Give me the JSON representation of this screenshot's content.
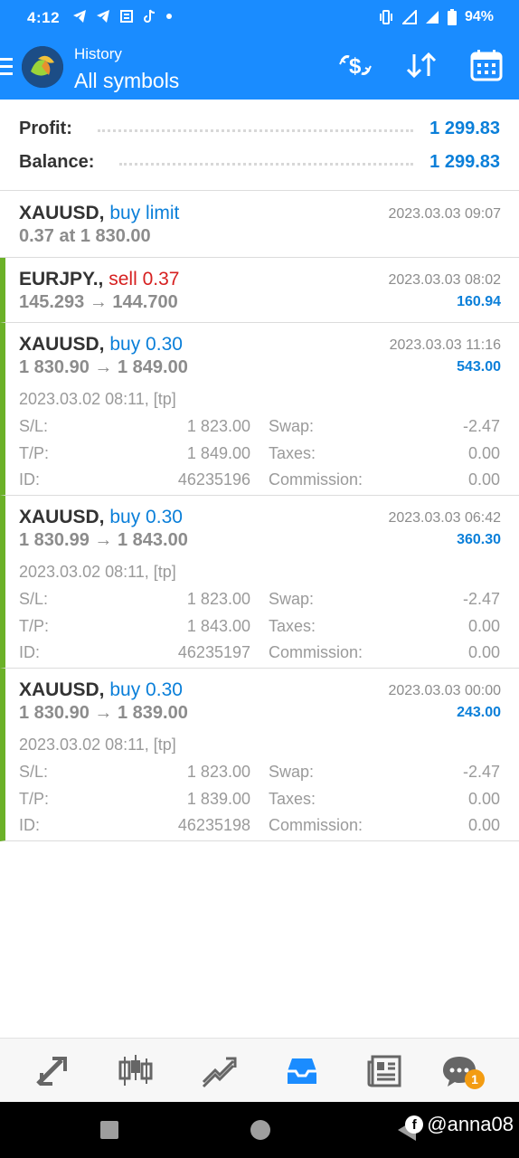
{
  "status_bar": {
    "time": "4:12",
    "battery": "94%"
  },
  "header": {
    "subtitle": "History",
    "title": "All symbols"
  },
  "summary": {
    "profit_label": "Profit:",
    "profit_value": "1 299.83",
    "balance_label": "Balance:",
    "balance_value": "1 299.83"
  },
  "trades": [
    {
      "symbol": "XAUUSD,",
      "action": "buy limit",
      "action_type": "buy",
      "line2": "0.37 at 1 830.00",
      "time": "2023.03.03 09:07",
      "profit": "",
      "closed": false
    },
    {
      "symbol": "EURJPY.,",
      "action": "sell 0.37",
      "action_type": "sell",
      "line2": "145.293 → 144.700",
      "time": "2023.03.03 08:02",
      "profit": "160.94",
      "closed": true
    },
    {
      "symbol": "XAUUSD,",
      "action": "buy 0.30",
      "action_type": "buy",
      "line2": "1 830.90 → 1 849.00",
      "time": "2023.03.03 11:16",
      "profit": "543.00",
      "closed": true,
      "open_info": "2023.03.02 08:11, [tp]",
      "sl": "1 823.00",
      "tp": "1 849.00",
      "id": "46235196",
      "swap": "-2.47",
      "taxes": "0.00",
      "commission": "0.00"
    },
    {
      "symbol": "XAUUSD,",
      "action": "buy 0.30",
      "action_type": "buy",
      "line2": "1 830.99 → 1 843.00",
      "time": "2023.03.03 06:42",
      "profit": "360.30",
      "closed": true,
      "open_info": "2023.03.02 08:11, [tp]",
      "sl": "1 823.00",
      "tp": "1 843.00",
      "id": "46235197",
      "swap": "-2.47",
      "taxes": "0.00",
      "commission": "0.00"
    },
    {
      "symbol": "XAUUSD,",
      "action": "buy 0.30",
      "action_type": "buy",
      "line2": "1 830.90 → 1 839.00",
      "time": "2023.03.03 00:00",
      "profit": "243.00",
      "closed": true,
      "open_info": "2023.03.02 08:11, [tp]",
      "sl": "1 823.00",
      "tp": "1 839.00",
      "id": "46235198",
      "swap": "-2.47",
      "taxes": "0.00",
      "commission": "0.00"
    }
  ],
  "labels": {
    "sl": "S/L:",
    "tp": "T/P:",
    "id": "ID:",
    "swap": "Swap:",
    "taxes": "Taxes:",
    "commission": "Commission:"
  },
  "bottom_nav": {
    "items": [
      "quotes-icon",
      "chart-icon",
      "trade-icon",
      "history-icon",
      "news-icon",
      "messages-icon"
    ],
    "active": "history-icon",
    "badge": "1"
  },
  "watermark": "@anna08",
  "colors": {
    "accent": "#1a8cff",
    "buy": "#0a7fd9",
    "sell": "#d61f1f",
    "closed_bar": "#6bb128"
  }
}
